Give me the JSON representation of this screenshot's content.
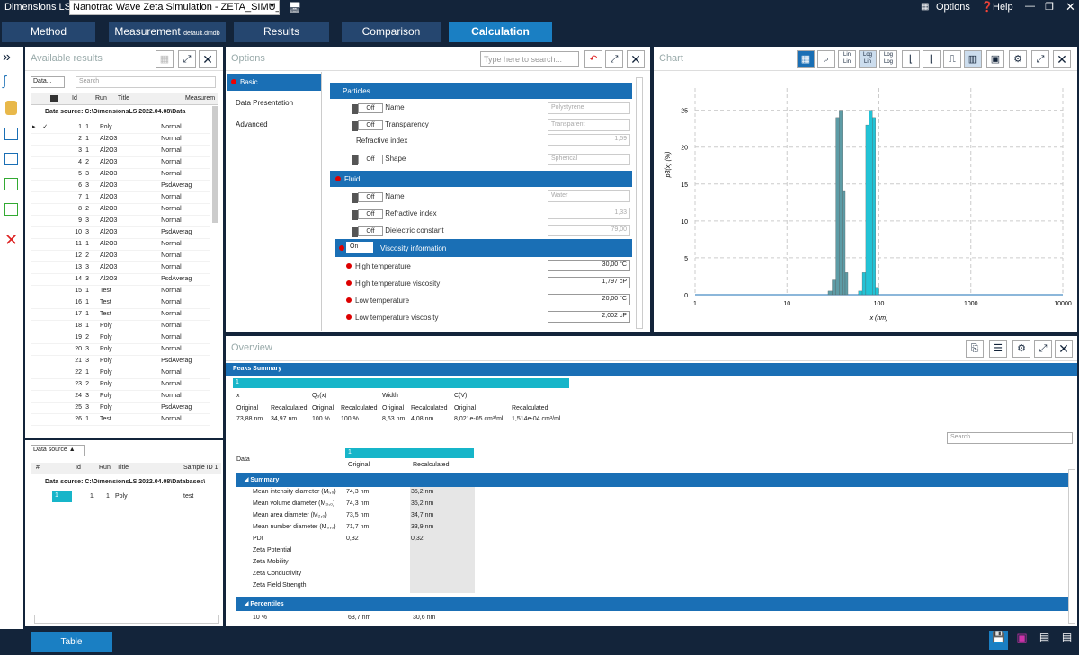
{
  "app": {
    "name": "Dimensions LS",
    "file": "Nanotrac Wave Zeta Simulation - ZETA_SIMU_123",
    "options": "Options",
    "help": "Help"
  },
  "nav": {
    "method": "Method",
    "measurement": "Measurement",
    "measurement_file": "default.dmdb",
    "results": "Results",
    "comparison": "Comparison",
    "calculation": "Calculation"
  },
  "avail": {
    "title": "Available results",
    "filter": "Data...",
    "search_placeholder": "Search",
    "cols": [
      "Id",
      "Run",
      "Title",
      "Measurem"
    ],
    "group": "Data source: C:\\DimensionsLS 2022.04.08\\Data",
    "rows": [
      [
        "1",
        "1",
        "Poly",
        "Normal"
      ],
      [
        "2",
        "1",
        "Al2O3",
        "Normal"
      ],
      [
        "3",
        "1",
        "Al2O3",
        "Normal"
      ],
      [
        "4",
        "2",
        "Al2O3",
        "Normal"
      ],
      [
        "5",
        "3",
        "Al2O3",
        "Normal"
      ],
      [
        "6",
        "3",
        "Al2O3",
        "PsdAverag"
      ],
      [
        "7",
        "1",
        "Al2O3",
        "Normal"
      ],
      [
        "8",
        "2",
        "Al2O3",
        "Normal"
      ],
      [
        "9",
        "3",
        "Al2O3",
        "Normal"
      ],
      [
        "10",
        "3",
        "Al2O3",
        "PsdAverag"
      ],
      [
        "11",
        "1",
        "Al2O3",
        "Normal"
      ],
      [
        "12",
        "2",
        "Al2O3",
        "Normal"
      ],
      [
        "13",
        "3",
        "Al2O3",
        "Normal"
      ],
      [
        "14",
        "3",
        "Al2O3",
        "PsdAverag"
      ],
      [
        "15",
        "1",
        "Test",
        "Normal"
      ],
      [
        "16",
        "1",
        "Test",
        "Normal"
      ],
      [
        "17",
        "1",
        "Test",
        "Normal"
      ],
      [
        "18",
        "1",
        "Poly",
        "Normal"
      ],
      [
        "19",
        "2",
        "Poly",
        "Normal"
      ],
      [
        "20",
        "3",
        "Poly",
        "Normal"
      ],
      [
        "21",
        "3",
        "Poly",
        "PsdAverag"
      ],
      [
        "22",
        "1",
        "Poly",
        "Normal"
      ],
      [
        "23",
        "2",
        "Poly",
        "Normal"
      ],
      [
        "24",
        "3",
        "Poly",
        "Normal"
      ],
      [
        "25",
        "3",
        "Poly",
        "PsdAverag"
      ],
      [
        "26",
        "1",
        "Test",
        "Normal"
      ]
    ]
  },
  "sel": {
    "filter": "Data source",
    "cols": [
      "#",
      "Id",
      "Run",
      "Title",
      "Sample ID 1"
    ],
    "group": "Data source: C:\\DimensionsLS 2022.04.08\\Databases\\",
    "row": [
      "1",
      "1",
      "1",
      "Poly",
      "test"
    ]
  },
  "options": {
    "title": "Options",
    "search_placeholder": "Type here to search...",
    "tabs": [
      "Basic",
      "Data Presentation",
      "Advanced"
    ],
    "particles": "Particles",
    "fluid": "Fluid",
    "off": "Off",
    "on": "On",
    "p_name": "Name",
    "p_name_val": "Polystyrene",
    "p_transp": "Transparency",
    "p_transp_val": "Transparent",
    "p_ri": "Refractive index",
    "p_ri_val": "1,59",
    "p_shape": "Shape",
    "p_shape_val": "Spherical",
    "f_name": "Name",
    "f_name_val": "Water",
    "f_ri": "Refractive index",
    "f_ri_val": "1,33",
    "f_dc": "Dielectric constant",
    "f_dc_val": "79,00",
    "visc": "Viscosity information",
    "ht": "High temperature",
    "ht_val": "30,00 °C",
    "htv": "High temperature viscosity",
    "htv_val": "1,797 cP",
    "lt": "Low temperature",
    "lt_val": "20,00 °C",
    "ltv": "Low temperature viscosity",
    "ltv_val": "2,002 cP"
  },
  "chart": {
    "title": "Chart"
  },
  "chart_data": {
    "type": "bar",
    "xlabel": "x (nm)",
    "ylabel": "p3(x) (%)",
    "xscale": "log",
    "xlim": [
      1,
      10000
    ],
    "ylim": [
      0,
      28
    ],
    "xticks": [
      "1",
      "10",
      "100",
      "1000",
      "10000"
    ],
    "yticks": [
      "0",
      "5",
      "10",
      "15",
      "20",
      "25"
    ],
    "grid": true,
    "series": [
      {
        "color": "#5d9ca6",
        "x": [
          25,
          28,
          31,
          34,
          37,
          40,
          43,
          46
        ],
        "values": [
          0,
          0.5,
          2,
          24,
          25,
          14,
          3,
          0
        ]
      },
      {
        "color": "#22c3d6",
        "x": [
          55,
          60,
          66,
          72,
          78,
          85,
          92,
          100
        ],
        "values": [
          0,
          0.5,
          3,
          23,
          25,
          24,
          1,
          0
        ]
      }
    ]
  },
  "overview": {
    "title": "Overview",
    "peaks_title": "Peaks Summary",
    "peak": "1",
    "h_x": "x",
    "h_q": "Q₃(x)",
    "h_w": "Width",
    "h_cv": "C(V)",
    "orig": "Original",
    "recalc": "Recalculated",
    "vals": [
      "73,88 nm",
      "34,97 nm",
      "100 %",
      "100 %",
      "8,63 nm",
      "4,08 nm",
      "8,021e-05 cm³/ml",
      "1,514e-04 cm³/ml"
    ],
    "search": "Search",
    "data": "Data",
    "col1": "1",
    "summary": "Summary",
    "percentiles": "Percentiles",
    "srows": [
      [
        "Mean intensity diameter (Mᵢ,₀)",
        "74,3 nm",
        "35,2 nm"
      ],
      [
        "Mean volume diameter (M₃,₀)",
        "74,3 nm",
        "35,2 nm"
      ],
      [
        "Mean area diameter (M₂,₀)",
        "73,5 nm",
        "34,7 nm"
      ],
      [
        "Mean number diameter (M₀,₀)",
        "71,7 nm",
        "33,9 nm"
      ],
      [
        "PDI",
        "0,32",
        "0,32"
      ],
      [
        "Zeta Potential",
        "",
        ""
      ],
      [
        "Zeta Mobility",
        "",
        ""
      ],
      [
        "Zeta Conductivity",
        "",
        ""
      ],
      [
        "Zeta Field Strength",
        "",
        ""
      ]
    ],
    "prow": [
      "10 %",
      "63,7 nm",
      "30,6 nm"
    ]
  },
  "footer": {
    "table": "Table"
  }
}
